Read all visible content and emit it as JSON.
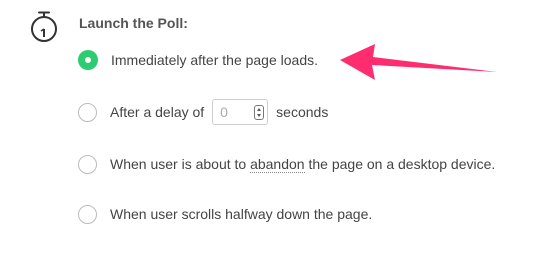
{
  "section": {
    "title": "Launch the Poll:",
    "icon": "stopwatch-icon"
  },
  "options": [
    {
      "label": "Immediately after the page loads.",
      "selected": true
    },
    {
      "label_before": "After a delay of",
      "input_value": "0",
      "label_after": "seconds",
      "selected": false
    },
    {
      "label_before": "When user is about to ",
      "label_link": "abandon",
      "label_after": " the page on a desktop device.",
      "selected": false
    },
    {
      "label": "When user scrolls halfway down the page.",
      "selected": false
    }
  ],
  "colors": {
    "selected_radio": "#2ecc71",
    "annotation_arrow": "#ff2d6f"
  }
}
